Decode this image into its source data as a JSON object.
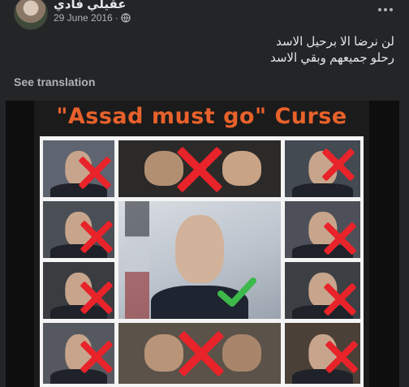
{
  "post": {
    "author": "عقيلي فادي",
    "date": "29 June 2016",
    "dot": "·",
    "privacy_icon": "globe-icon",
    "text_line1": "لن نرضا الا برحيل الاسد",
    "text_line2": "رحلو جميعهم وبقي الاسد",
    "see_translation": "See translation"
  },
  "image": {
    "headline": "\"Assad must go\" Curse",
    "colors": {
      "headline": "#e8612b",
      "cross": "#e8232a",
      "check": "#3db84a"
    }
  }
}
